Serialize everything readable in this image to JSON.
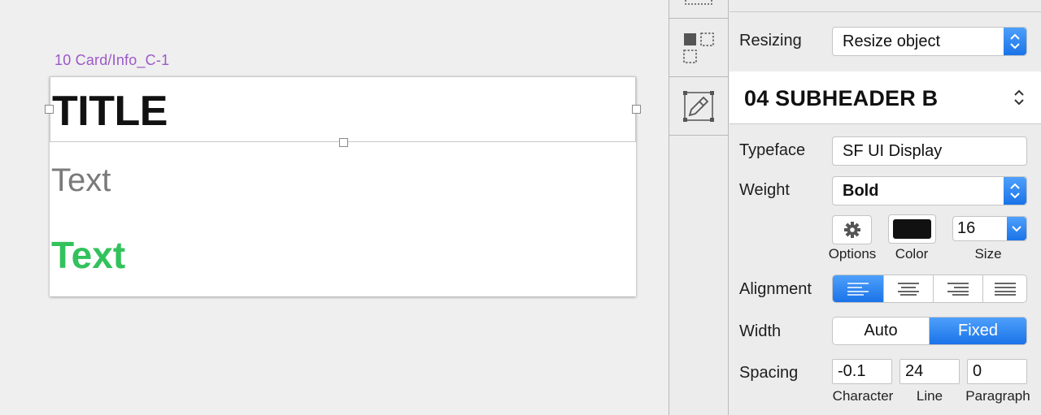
{
  "canvas": {
    "artboard_label": "10 Card/Info_C-1",
    "card": {
      "title": "TITLE",
      "text_gray": "Text",
      "text_green": "Text"
    }
  },
  "inspector": {
    "resizing": {
      "label": "Resizing",
      "value": "Resize object"
    },
    "text_style": {
      "name": "04 SUBHEADER B"
    },
    "typeface": {
      "label": "Typeface",
      "value": "SF UI Display"
    },
    "weight": {
      "label": "Weight",
      "value": "Bold"
    },
    "options_label": "Options",
    "color_label": "Color",
    "text_color": "#111111",
    "size": {
      "label": "Size",
      "value": "16"
    },
    "alignment": {
      "label": "Alignment",
      "options": [
        "left",
        "center",
        "right",
        "justify"
      ],
      "selected": "left"
    },
    "width": {
      "label": "Width",
      "auto": "Auto",
      "fixed": "Fixed",
      "selected": "Fixed"
    },
    "spacing": {
      "label": "Spacing",
      "character": {
        "value": "-0.1",
        "label": "Character"
      },
      "line": {
        "value": "24",
        "label": "Line"
      },
      "paragraph": {
        "value": "0",
        "label": "Paragraph"
      }
    }
  },
  "colors": {
    "accent": "#1a73e8",
    "artboard_label": "#9b59c9",
    "green_text": "#32c25c",
    "gray_text": "#7a7a7a"
  },
  "icons": {
    "tool_top": "dashed-rect-icon",
    "tool_middle": "symbols-grid-icon",
    "tool_bottom": "edit-frame-icon",
    "options": "gear-icon"
  }
}
